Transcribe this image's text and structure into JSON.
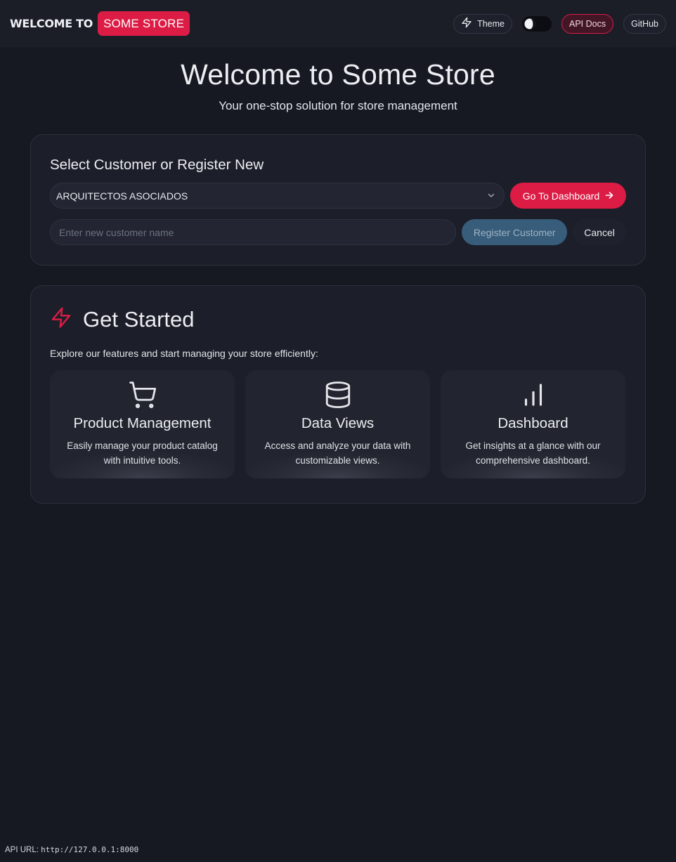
{
  "header": {
    "brand_prefix": "WELCOME TO",
    "brand_name": "SOME STORE",
    "theme_label": "Theme",
    "api_docs_label": "API Docs",
    "github_label": "GitHub",
    "dark_mode": true
  },
  "hero": {
    "title": "Welcome to Some Store",
    "subtitle": "Your one-stop solution for store management"
  },
  "customer": {
    "heading": "Select Customer or Register New",
    "selected_customer": "ARQUITECTOS ASOCIADOS",
    "go_button": "Go To Dashboard",
    "new_customer_value": "",
    "new_customer_placeholder": "Enter new customer name",
    "register_button": "Register Customer",
    "cancel_button": "Cancel"
  },
  "get_started": {
    "title": "Get Started",
    "description": "Explore our features and start managing your store efficiently:",
    "features": [
      {
        "icon": "shopping-cart-icon",
        "title": "Product Management",
        "description": "Easily manage your product catalog with intuitive tools."
      },
      {
        "icon": "database-icon",
        "title": "Data Views",
        "description": "Access and analyze your data with customizable views."
      },
      {
        "icon": "bar-chart-icon",
        "title": "Dashboard",
        "description": "Get insights at a glance with our comprehensive dashboard."
      }
    ]
  },
  "footer": {
    "api_url_label": "API URL:",
    "api_url": "http://127.0.0.1:8000"
  },
  "colors": {
    "accent": "#dc1c45",
    "background": "#161922",
    "card": "#1c1f29",
    "register_button": "#375d7b"
  }
}
